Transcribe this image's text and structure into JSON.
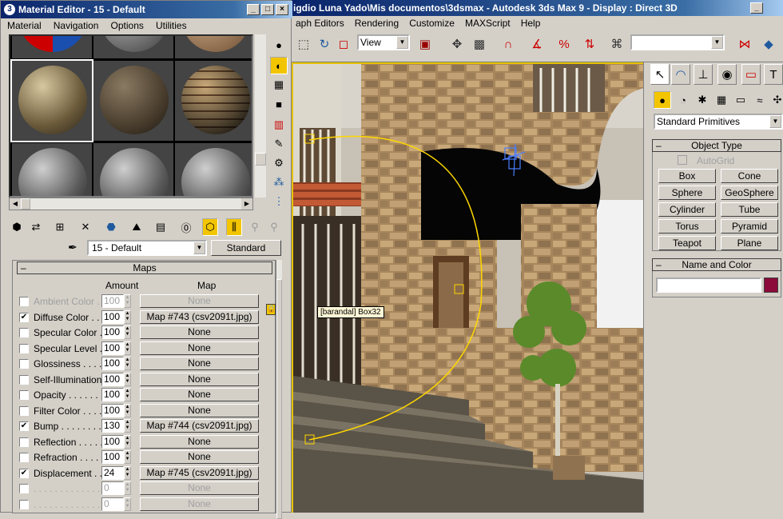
{
  "max": {
    "title": "igdio Luna Yado\\Mis documentos\\3dsmax  - Autodesk 3ds Max 9     - Display : Direct 3D",
    "menu": [
      "aph Editors",
      "Rendering",
      "Customize",
      "MAXScript",
      "Help"
    ],
    "view_dropdown": "View",
    "viewport_tooltip": "[barandal] Box32"
  },
  "command_panel": {
    "category_dropdown": "Standard Primitives",
    "object_type_head": "Object Type",
    "autogrid_label": "AutoGrid",
    "buttons": [
      "Box",
      "Cone",
      "Sphere",
      "GeoSphere",
      "Cylinder",
      "Tube",
      "Torus",
      "Pyramid",
      "Teapot",
      "Plane"
    ],
    "name_color_head": "Name and Color",
    "name_value": "",
    "swatch_color": "#8b0a3a"
  },
  "material_editor": {
    "title": "Material Editor - 15 - Default",
    "minimize": "_",
    "maximize": "□",
    "close": "×",
    "menu": [
      "Material",
      "Navigation",
      "Options",
      "Utilities"
    ],
    "material_name": "15 - Default",
    "material_type": "Standard",
    "maps_head": "Maps",
    "amount_header": "Amount",
    "map_header": "Map",
    "minus": "–",
    "rows": [
      {
        "label": "Ambient Color . .",
        "amount": "100",
        "map": "None",
        "checked": false,
        "dim": true
      },
      {
        "label": "Diffuse Color . . .",
        "amount": "100",
        "map": "Map #743 (csv2091t.jpg)",
        "checked": true,
        "dim": false
      },
      {
        "label": "Specular Color . .",
        "amount": "100",
        "map": "None",
        "checked": false,
        "dim": false
      },
      {
        "label": "Specular Level .",
        "amount": "100",
        "map": "None",
        "checked": false,
        "dim": false
      },
      {
        "label": "Glossiness . . . . .",
        "amount": "100",
        "map": "None",
        "checked": false,
        "dim": false
      },
      {
        "label": "Self-Illumination .",
        "amount": "100",
        "map": "None",
        "checked": false,
        "dim": false
      },
      {
        "label": "Opacity . . . . . . .",
        "amount": "100",
        "map": "None",
        "checked": false,
        "dim": false
      },
      {
        "label": "Filter Color . . . .",
        "amount": "100",
        "map": "None",
        "checked": false,
        "dim": false
      },
      {
        "label": "Bump  . . . . . . . .",
        "amount": "130",
        "map": "Map #744 (csv2091t.jpg)",
        "checked": true,
        "dim": false
      },
      {
        "label": "Reflection  . . . . .",
        "amount": "100",
        "map": "None",
        "checked": false,
        "dim": false
      },
      {
        "label": "Refraction  . . . . .",
        "amount": "100",
        "map": "None",
        "checked": false,
        "dim": false
      },
      {
        "label": "Displacement . . .",
        "amount": "24",
        "map": "Map #745 (csv2091t.jpg)",
        "checked": true,
        "dim": false
      },
      {
        "label": ". . . . . . . . . . . . .",
        "amount": "0",
        "map": "None",
        "checked": false,
        "dim": true
      },
      {
        "label": ". . . . . . . . . . . . .",
        "amount": "0",
        "map": "None",
        "checked": false,
        "dim": true
      }
    ]
  }
}
